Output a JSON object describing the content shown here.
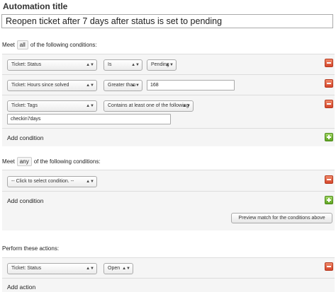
{
  "automation": {
    "title_label": "Automation title",
    "title_value": "Reopen ticket after 7 days after status is set to pending"
  },
  "all_conditions": {
    "prefix": "Meet",
    "mode": "all",
    "suffix": "of the following conditions:",
    "rows": [
      {
        "field": "Ticket: Status",
        "operator": "Is",
        "value": "Pending"
      },
      {
        "field": "Ticket: Hours since solved",
        "operator": "Greater than",
        "value": "168"
      },
      {
        "field": "Ticket: Tags",
        "operator": "Contains at least one of the following",
        "value": "checkin7days"
      }
    ],
    "add_label": "Add condition"
  },
  "any_conditions": {
    "prefix": "Meet",
    "mode": "any",
    "suffix": "of the following conditions:",
    "rows": [
      {
        "field": "-- Click to select condition. --"
      }
    ],
    "add_label": "Add condition"
  },
  "preview_label": "Preview match for the conditions above",
  "actions": {
    "heading": "Perform these actions:",
    "rows": [
      {
        "field": "Ticket: Status",
        "value": "Open"
      }
    ],
    "add_label": "Add action"
  },
  "icons": {
    "remove": "remove-icon",
    "add": "add-icon",
    "dropdown": "chevron-updown-icon"
  },
  "colors": {
    "remove": "#d4462b",
    "add": "#5fa321",
    "block_bg": "#f5f5f5"
  }
}
